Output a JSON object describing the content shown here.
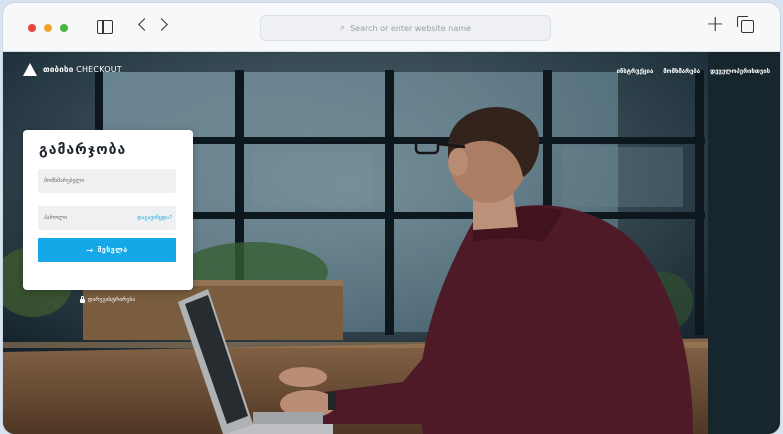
{
  "browser": {
    "address_placeholder": "Search or enter website name"
  },
  "brand": {
    "name_bold": "თიბისი",
    "name_rest": "CHECKOUT"
  },
  "nav": {
    "items": [
      "ინსტრუქცია",
      "მომხმარება",
      "დეველოპერისთვის"
    ]
  },
  "login": {
    "title": "გამარჯობა",
    "username_placeholder": "მომხმარებელი",
    "password_placeholder": "პაროლი",
    "forgot_link": "დაგავიწყდა?",
    "submit_label": "შესვლა",
    "register_link": "დარეგისტრირება"
  },
  "colors": {
    "accent": "#14a8e6",
    "link": "#1aa9e0"
  },
  "icons": {
    "mark": "triangle-logo-icon",
    "search": "search-icon",
    "lock": "lock-icon"
  }
}
